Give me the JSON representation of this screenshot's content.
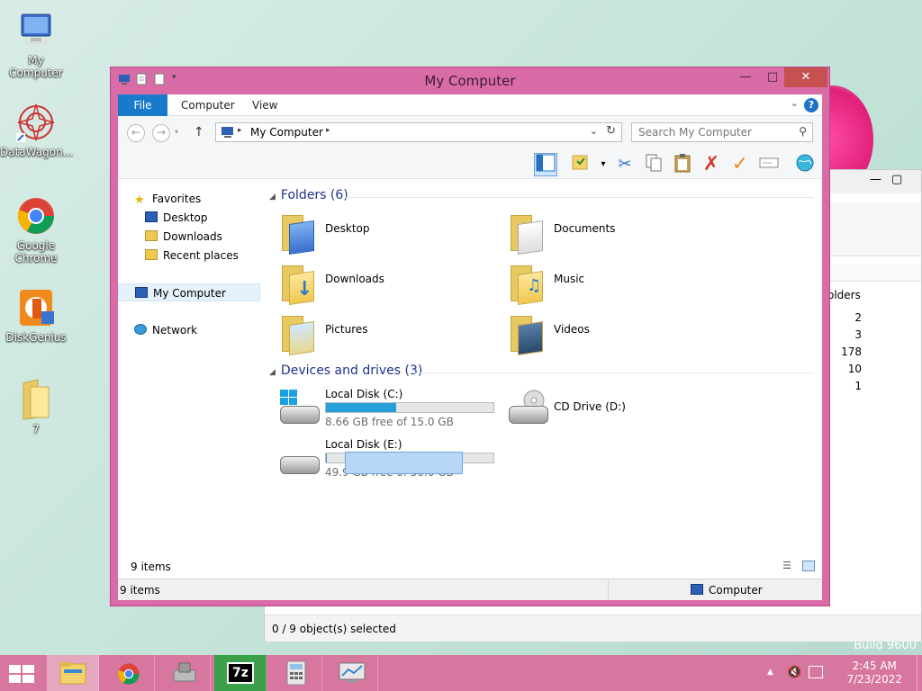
{
  "desktop": {
    "icons": [
      {
        "label": "My Computer"
      },
      {
        "label": "DataWagon..."
      },
      {
        "label": "Google Chrome"
      },
      {
        "label": "DiskGenius"
      },
      {
        "label": "7"
      }
    ],
    "build_text": "Build 9600"
  },
  "background_window": {
    "column_header": "olders",
    "values": [
      "2",
      "3",
      "178",
      "10",
      "1"
    ],
    "status": "0 / 9 object(s) selected"
  },
  "window": {
    "title": "My Computer",
    "tabs": [
      "File",
      "Computer",
      "View"
    ],
    "help_label": "?",
    "address_path": "My Computer",
    "search_placeholder": "Search My Computer",
    "nav": {
      "favorites": "Favorites",
      "favorites_items": [
        "Desktop",
        "Downloads",
        "Recent places"
      ],
      "computer": "My Computer",
      "network": "Network"
    },
    "folders_header": "Folders (6)",
    "folders": [
      "Desktop",
      "Documents",
      "Downloads",
      "Music",
      "Pictures",
      "Videos"
    ],
    "drives_header": "Devices and drives (3)",
    "drives": [
      {
        "name": "Local Disk (C:)",
        "free": "8.66 GB free of 15.0 GB",
        "used_fraction": 0.42
      },
      {
        "name": "CD Drive (D:)"
      },
      {
        "name": "Local Disk (E:)",
        "free": "49.9 GB free of 50.0 GB",
        "used_fraction": 0.002
      }
    ],
    "items_count": "9 items",
    "status_count": "9 items",
    "status_location": "Computer"
  },
  "taskbar": {
    "time": "2:45 AM",
    "date": "7/23/2022",
    "sevenzip_label": "7z"
  },
  "colors": {
    "accent": "#d96ca6",
    "file_tab": "#1979ca",
    "disk_fill": "#26a0da",
    "taskbar": "#d7779f"
  }
}
